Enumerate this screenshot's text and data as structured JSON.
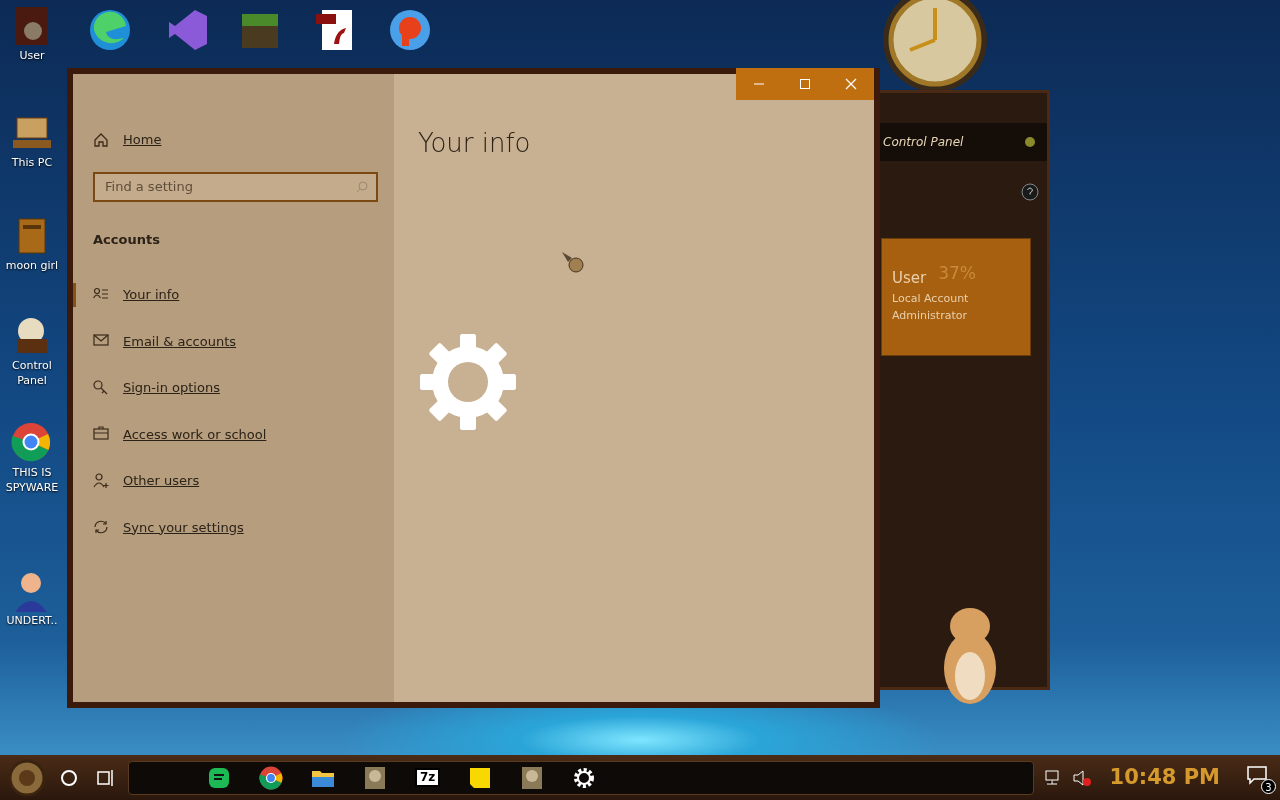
{
  "desktop_icons": [
    {
      "label": "User",
      "kind": "cabinet"
    },
    {
      "label": "This PC",
      "kind": "computer"
    },
    {
      "label": "moon girl",
      "kind": "box"
    },
    {
      "label": "Control Panel",
      "kind": "lamp"
    },
    {
      "label": "THIS IS SPYWARE",
      "kind": "chrome"
    },
    {
      "label": "UNDERT..",
      "kind": "figure"
    }
  ],
  "settings_window": {
    "sidebar": {
      "home": "Home",
      "search": {
        "placeholder": "Find a setting"
      },
      "section": "Accounts",
      "items": [
        {
          "label": "Your info",
          "selected": true
        },
        {
          "label": "Email & accounts",
          "selected": false
        },
        {
          "label": "Sign-in options",
          "selected": false
        },
        {
          "label": "Access work or school",
          "selected": false
        },
        {
          "label": "Other users",
          "selected": false
        },
        {
          "label": "Sync your settings",
          "selected": false
        }
      ]
    },
    "page_title": "Your info"
  },
  "control_panel_window": {
    "title": "Control Panel",
    "user": {
      "name": "User",
      "type": "Local Account",
      "role": "Administrator",
      "reading": "37%"
    }
  },
  "taskbar": {
    "apps": [
      {
        "kind": "notes"
      },
      {
        "kind": "chrome"
      },
      {
        "kind": "folder"
      },
      {
        "kind": "photo"
      },
      {
        "kind": "archive",
        "label": "7z"
      },
      {
        "kind": "sticky"
      },
      {
        "kind": "photo"
      },
      {
        "kind": "gear"
      }
    ],
    "clock": "10:48 PM",
    "notification_count": "3"
  }
}
